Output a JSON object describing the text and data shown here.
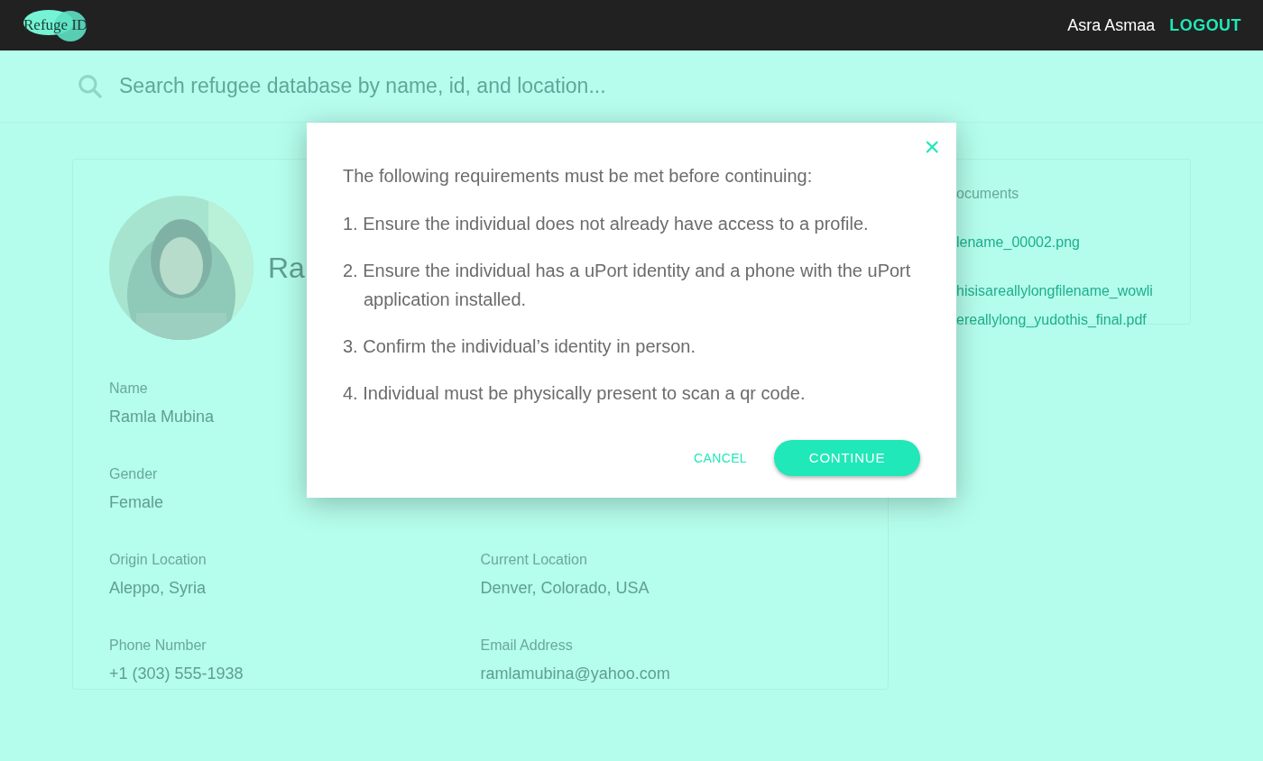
{
  "header": {
    "logo": "Refuge ID",
    "user": "Asra Asmaa",
    "logout": "LOGOUT"
  },
  "search": {
    "placeholder": "Search refugee database by name, id, and location..."
  },
  "profile": {
    "name_partial": "Ra",
    "rows": [
      [
        {
          "label": "Name",
          "value": "Ramla Mubina"
        }
      ],
      [
        {
          "label": "Gender",
          "value": "Female"
        }
      ],
      [
        {
          "label": "Origin Location",
          "value": "Aleppo, Syria"
        },
        {
          "label": "Current Location",
          "value": "Denver, Colorado, USA"
        }
      ],
      [
        {
          "label": "Phone Number",
          "value": "+1 (303) 555-1938"
        },
        {
          "label": "Email Address",
          "value": "ramlamubina@yahoo.com"
        }
      ]
    ]
  },
  "documents": {
    "title": "ocuments",
    "files": [
      [
        "lename_00002.png"
      ],
      [
        "hisisareallylongfilename_wowli",
        "ereallylong_yudothis_final.pdf"
      ]
    ]
  },
  "modal": {
    "intro": "The following requirements must be met before continuing:",
    "requirements": [
      {
        "number": "1.",
        "text": "Ensure the individual does not already have access to a profile."
      },
      {
        "number": "2.",
        "text": "Ensure the individual has a uPort identity and a phone with the uPort application installed."
      },
      {
        "number": "3.",
        "text": "Confirm the individual’s identity in person."
      },
      {
        "number": "4.",
        "text": "Individual must be physically present to scan a qr code."
      }
    ],
    "close": "×",
    "cancel": "CANCEL",
    "continue": "CONTINUE"
  }
}
